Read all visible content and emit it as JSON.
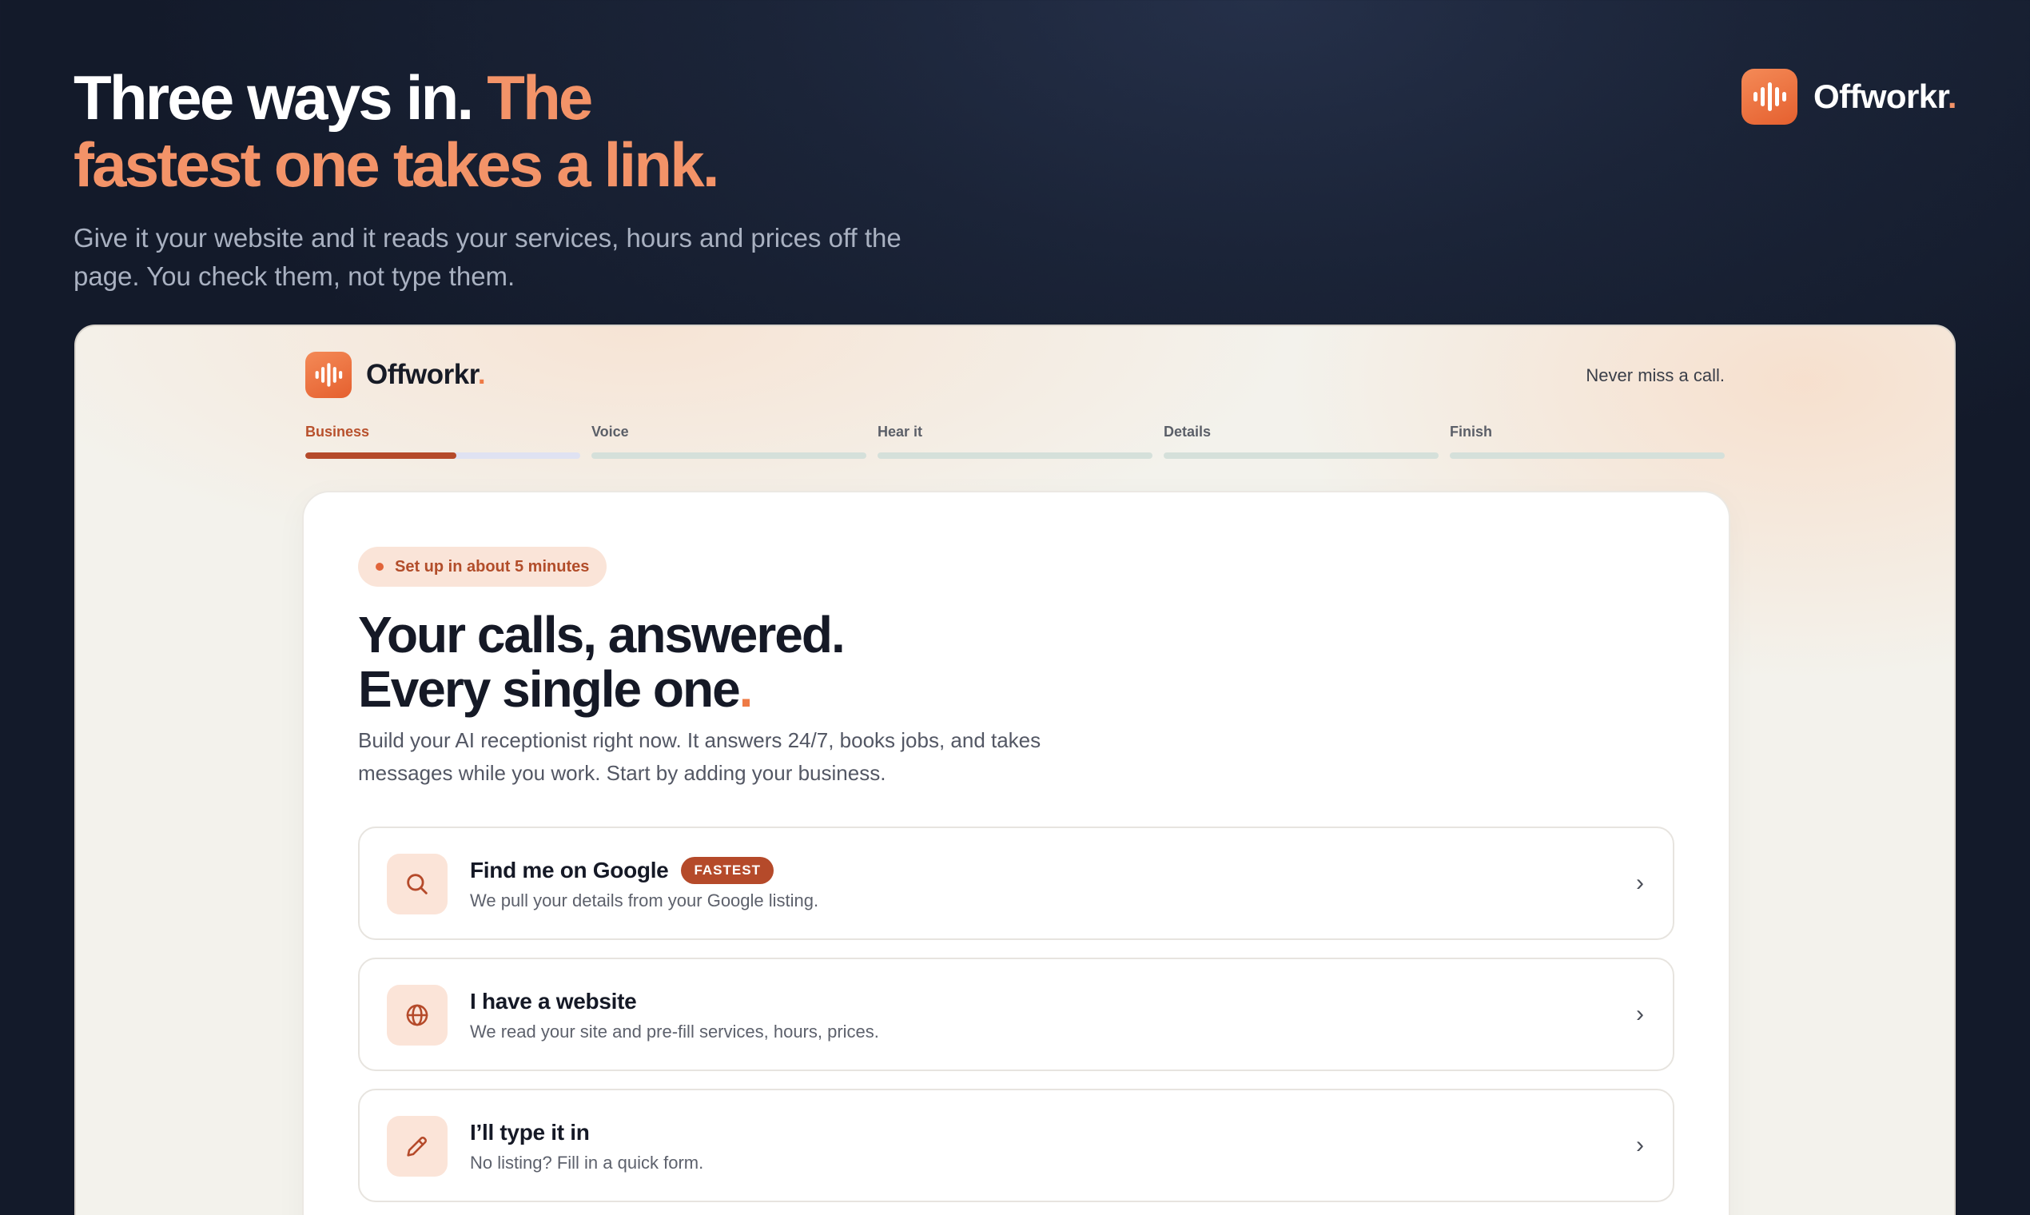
{
  "hero": {
    "title_white": "Three ways in.",
    "title_accent_line1": "The",
    "title_accent_line2": "fastest one takes a link.",
    "subtitle": "Give it your website and it reads your services, hours and prices off the page. You check them, not type them."
  },
  "brand": {
    "name": "Offworkr",
    "dot": ".",
    "logo_icon": "soundwave-icon",
    "accent_color": "#f39368"
  },
  "app": {
    "tagline": "Never miss a call.",
    "steps": [
      {
        "label": "Business",
        "progress": 0.55
      },
      {
        "label": "Voice",
        "progress": 0
      },
      {
        "label": "Hear it",
        "progress": 0
      },
      {
        "label": "Details",
        "progress": 0
      },
      {
        "label": "Finish",
        "progress": 0
      }
    ],
    "card": {
      "pill": "Set up in about 5 minutes",
      "title_line1": "Your calls, answered.",
      "title_line2": "Every single one",
      "title_dot": ".",
      "subtitle": "Build your AI receptionist right now. It answers 24/7, books jobs, and takes messages while you work. Start by adding your business.",
      "options": [
        {
          "title": "Find me on Google",
          "badge": "FASTEST",
          "desc": "We pull your details from your Google listing.",
          "icon": "search-icon"
        },
        {
          "title": "I have a website",
          "badge": "",
          "desc": "We read your site and pre-fill services, hours, prices.",
          "icon": "globe-icon"
        },
        {
          "title": "I’ll type it in",
          "badge": "",
          "desc": "No listing? Fill in a quick form.",
          "icon": "pencil-icon"
        }
      ],
      "chevron": "›"
    }
  }
}
